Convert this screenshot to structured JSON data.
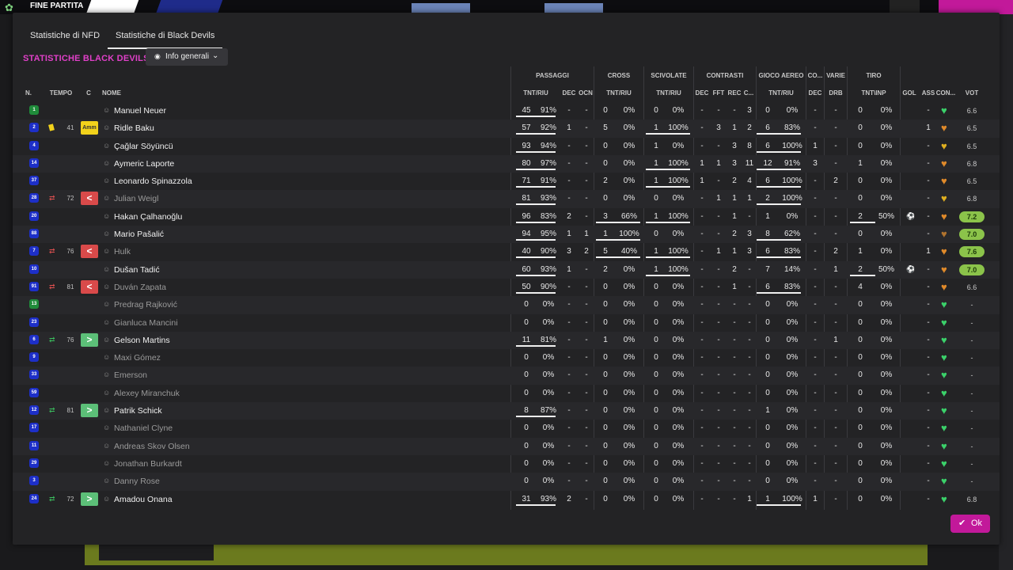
{
  "background": {
    "top_label": "FINE PARTITA"
  },
  "tabs": [
    {
      "label": "Statistiche di NFD",
      "active": false
    },
    {
      "label": "Statistiche di Black Devils",
      "active": true
    }
  ],
  "section_title": "STATISTICHE BLACK DEVILS",
  "view_dropdown": {
    "selected": "Info generali",
    "icon": "eye-icon"
  },
  "column_groups": {
    "passaggi": "PASSAGGI",
    "cross": "CROSS",
    "scivolate": "SCIVOLATE",
    "contrasti": "CONTRASTI",
    "gioco_aereo": "GIOCO AEREO",
    "co": "CO...",
    "varie": "VARIE",
    "tiro": "TIRO"
  },
  "columns": {
    "n": "N.",
    "tempo": "TEMPO",
    "c": "C",
    "nome": "NOME",
    "pass_tntriu": "TNT/RIU",
    "pass_dec": "DEC",
    "pass_ocn": "OCN",
    "cross_tntriu": "TNT/RIU",
    "sciv_tntriu": "TNT/RIU",
    "con_dec": "DEC",
    "con_fft": "FFT",
    "con_rec": "REC",
    "con_c": "C...",
    "aereo_tntriu": "TNT/RIU",
    "co_dec": "DEC",
    "varie_drb": "DRB",
    "tiro_tntinp": "TNT\\INP",
    "gol": "GOL",
    "ass": "ASS",
    "con": "CON...",
    "vot": "VOT"
  },
  "players": [
    {
      "n": "1",
      "nc": "green",
      "tempo": "",
      "tipo": "",
      "c": "",
      "cbox": "",
      "name": "Manuel Neuer",
      "dim": false,
      "pt": "45",
      "pp": "91%",
      "pd": "-",
      "po": "-",
      "ct": "0",
      "cp": "0%",
      "st": "0",
      "sp": "0%",
      "kd": "-",
      "kf": "-",
      "kr": "-",
      "kc": "3",
      "at": "0",
      "ap": "0%",
      "od": "-",
      "vd": "-",
      "tt": "0",
      "tp": "0%",
      "gol": "",
      "ass": "-",
      "heart": "green",
      "vot": "6.6",
      "good": false,
      "bar_p": true,
      "bar_c": false,
      "bar_s": false,
      "bar_a": false,
      "bar_t": false
    },
    {
      "n": "2",
      "nc": "blue",
      "tempo": "41",
      "tipo": "card",
      "c": "Amm",
      "cbox": "amm",
      "name": "Ridle Baku",
      "dim": false,
      "pt": "57",
      "pp": "92%",
      "pd": "1",
      "po": "-",
      "ct": "5",
      "cp": "0%",
      "st": "1",
      "sp": "100%",
      "kd": "-",
      "kf": "3",
      "kr": "1",
      "kc": "2",
      "at": "6",
      "ap": "83%",
      "od": "-",
      "vd": "-",
      "tt": "0",
      "tp": "0%",
      "gol": "",
      "ass": "1",
      "heart": "orange",
      "vot": "6.5",
      "good": false,
      "bar_p": true,
      "bar_c": false,
      "bar_s": true,
      "bar_a": true,
      "bar_t": false
    },
    {
      "n": "4",
      "nc": "blue",
      "tempo": "",
      "tipo": "",
      "c": "",
      "cbox": "",
      "name": "Çağlar Söyüncü",
      "dim": false,
      "pt": "93",
      "pp": "94%",
      "pd": "-",
      "po": "-",
      "ct": "0",
      "cp": "0%",
      "st": "1",
      "sp": "0%",
      "kd": "-",
      "kf": "-",
      "kr": "3",
      "kc": "8",
      "at": "6",
      "ap": "100%",
      "od": "1",
      "vd": "-",
      "tt": "0",
      "tp": "0%",
      "gol": "",
      "ass": "-",
      "heart": "yellow",
      "vot": "6.5",
      "good": false,
      "bar_p": true,
      "bar_c": false,
      "bar_s": false,
      "bar_a": true,
      "bar_t": false
    },
    {
      "n": "14",
      "nc": "blue",
      "tempo": "",
      "tipo": "",
      "c": "",
      "cbox": "",
      "name": "Aymeric Laporte",
      "dim": false,
      "pt": "80",
      "pp": "97%",
      "pd": "-",
      "po": "-",
      "ct": "0",
      "cp": "0%",
      "st": "1",
      "sp": "100%",
      "kd": "1",
      "kf": "1",
      "kr": "3",
      "kc": "11",
      "at": "12",
      "ap": "91%",
      "od": "3",
      "vd": "-",
      "tt": "1",
      "tp": "0%",
      "gol": "",
      "ass": "-",
      "heart": "orange",
      "vot": "6.8",
      "good": false,
      "bar_p": true,
      "bar_c": false,
      "bar_s": true,
      "bar_a": true,
      "bar_t": false
    },
    {
      "n": "37",
      "nc": "blue",
      "tempo": "",
      "tipo": "",
      "c": "",
      "cbox": "",
      "name": "Leonardo Spinazzola",
      "dim": false,
      "pt": "71",
      "pp": "91%",
      "pd": "-",
      "po": "-",
      "ct": "2",
      "cp": "0%",
      "st": "1",
      "sp": "100%",
      "kd": "1",
      "kf": "-",
      "kr": "2",
      "kc": "4",
      "at": "6",
      "ap": "100%",
      "od": "-",
      "vd": "2",
      "tt": "0",
      "tp": "0%",
      "gol": "",
      "ass": "-",
      "heart": "orange",
      "vot": "6.5",
      "good": false,
      "bar_p": true,
      "bar_c": false,
      "bar_s": true,
      "bar_a": true,
      "bar_t": false
    },
    {
      "n": "28",
      "nc": "blue",
      "tempo": "72",
      "tipo": "out",
      "c": "<",
      "cbox": "red",
      "name": "Julian Weigl",
      "dim": true,
      "pt": "81",
      "pp": "93%",
      "pd": "-",
      "po": "-",
      "ct": "0",
      "cp": "0%",
      "st": "0",
      "sp": "0%",
      "kd": "-",
      "kf": "1",
      "kr": "1",
      "kc": "1",
      "at": "2",
      "ap": "100%",
      "od": "-",
      "vd": "-",
      "tt": "0",
      "tp": "0%",
      "gol": "",
      "ass": "-",
      "heart": "yellow",
      "vot": "6.8",
      "good": false,
      "bar_p": true,
      "bar_c": false,
      "bar_s": false,
      "bar_a": true,
      "bar_t": false
    },
    {
      "n": "20",
      "nc": "blue",
      "tempo": "",
      "tipo": "",
      "c": "",
      "cbox": "",
      "name": "Hakan Çalhanoğlu",
      "dim": false,
      "pt": "96",
      "pp": "83%",
      "pd": "2",
      "po": "-",
      "ct": "3",
      "cp": "66%",
      "st": "1",
      "sp": "100%",
      "kd": "-",
      "kf": "-",
      "kr": "1",
      "kc": "-",
      "at": "1",
      "ap": "0%",
      "od": "-",
      "vd": "-",
      "tt": "2",
      "tp": "50%",
      "gol": "ball",
      "ass": "-",
      "heart": "orange",
      "vot": "7.2",
      "good": true,
      "bar_p": true,
      "bar_c": true,
      "bar_s": true,
      "bar_a": false,
      "bar_t": true
    },
    {
      "n": "88",
      "nc": "blue",
      "tempo": "",
      "tipo": "",
      "c": "",
      "cbox": "",
      "name": "Mario Pašalić",
      "dim": false,
      "pt": "94",
      "pp": "95%",
      "pd": "1",
      "po": "1",
      "ct": "1",
      "cp": "100%",
      "st": "0",
      "sp": "0%",
      "kd": "-",
      "kf": "-",
      "kr": "2",
      "kc": "3",
      "at": "8",
      "ap": "62%",
      "od": "-",
      "vd": "-",
      "tt": "0",
      "tp": "0%",
      "gol": "",
      "ass": "-",
      "heart": "brown",
      "vot": "7.0",
      "good": true,
      "bar_p": true,
      "bar_c": true,
      "bar_s": false,
      "bar_a": true,
      "bar_t": false
    },
    {
      "n": "7",
      "nc": "blue",
      "tempo": "76",
      "tipo": "out",
      "c": "<",
      "cbox": "red",
      "name": "Hulk",
      "dim": true,
      "pt": "40",
      "pp": "90%",
      "pd": "3",
      "po": "2",
      "ct": "5",
      "cp": "40%",
      "st": "1",
      "sp": "100%",
      "kd": "-",
      "kf": "1",
      "kr": "1",
      "kc": "3",
      "at": "6",
      "ap": "83%",
      "od": "-",
      "vd": "2",
      "tt": "1",
      "tp": "0%",
      "gol": "",
      "ass": "1",
      "heart": "orange",
      "vot": "7.6",
      "good": true,
      "bar_p": true,
      "bar_c": true,
      "bar_s": true,
      "bar_a": true,
      "bar_t": false
    },
    {
      "n": "10",
      "nc": "blue",
      "tempo": "",
      "tipo": "",
      "c": "",
      "cbox": "",
      "name": "Dušan Tadić",
      "dim": false,
      "pt": "60",
      "pp": "93%",
      "pd": "1",
      "po": "-",
      "ct": "2",
      "cp": "0%",
      "st": "1",
      "sp": "100%",
      "kd": "-",
      "kf": "-",
      "kr": "2",
      "kc": "-",
      "at": "7",
      "ap": "14%",
      "od": "-",
      "vd": "1",
      "tt": "2",
      "tp": "50%",
      "gol": "ball",
      "ass": "-",
      "heart": "orange",
      "vot": "7.0",
      "good": true,
      "bar_p": true,
      "bar_c": false,
      "bar_s": true,
      "bar_a": false,
      "bar_t": true
    },
    {
      "n": "91",
      "nc": "blue",
      "tempo": "81",
      "tipo": "out",
      "c": "<",
      "cbox": "red",
      "name": "Duván Zapata",
      "dim": true,
      "pt": "50",
      "pp": "90%",
      "pd": "-",
      "po": "-",
      "ct": "0",
      "cp": "0%",
      "st": "0",
      "sp": "0%",
      "kd": "-",
      "kf": "-",
      "kr": "1",
      "kc": "-",
      "at": "6",
      "ap": "83%",
      "od": "-",
      "vd": "-",
      "tt": "4",
      "tp": "0%",
      "gol": "",
      "ass": "-",
      "heart": "orange",
      "vot": "6.6",
      "good": false,
      "bar_p": true,
      "bar_c": false,
      "bar_s": false,
      "bar_a": true,
      "bar_t": false
    },
    {
      "n": "13",
      "nc": "green",
      "tempo": "",
      "tipo": "",
      "c": "",
      "cbox": "",
      "name": "Predrag Rajković",
      "dim": true,
      "pt": "0",
      "pp": "0%",
      "pd": "-",
      "po": "-",
      "ct": "0",
      "cp": "0%",
      "st": "0",
      "sp": "0%",
      "kd": "-",
      "kf": "-",
      "kr": "-",
      "kc": "-",
      "at": "0",
      "ap": "0%",
      "od": "-",
      "vd": "-",
      "tt": "0",
      "tp": "0%",
      "gol": "",
      "ass": "-",
      "heart": "green",
      "vot": "-",
      "good": false,
      "bar_p": false,
      "bar_c": false,
      "bar_s": false,
      "bar_a": false,
      "bar_t": false
    },
    {
      "n": "23",
      "nc": "blue",
      "tempo": "",
      "tipo": "",
      "c": "",
      "cbox": "",
      "name": "Gianluca Mancini",
      "dim": true,
      "pt": "0",
      "pp": "0%",
      "pd": "-",
      "po": "-",
      "ct": "0",
      "cp": "0%",
      "st": "0",
      "sp": "0%",
      "kd": "-",
      "kf": "-",
      "kr": "-",
      "kc": "-",
      "at": "0",
      "ap": "0%",
      "od": "-",
      "vd": "-",
      "tt": "0",
      "tp": "0%",
      "gol": "",
      "ass": "-",
      "heart": "green",
      "vot": "-",
      "good": false,
      "bar_p": false,
      "bar_c": false,
      "bar_s": false,
      "bar_a": false,
      "bar_t": false
    },
    {
      "n": "6",
      "nc": "blue",
      "tempo": "76",
      "tipo": "in",
      "c": ">",
      "cbox": "green",
      "name": "Gelson Martins",
      "dim": false,
      "pt": "11",
      "pp": "81%",
      "pd": "-",
      "po": "-",
      "ct": "1",
      "cp": "0%",
      "st": "0",
      "sp": "0%",
      "kd": "-",
      "kf": "-",
      "kr": "-",
      "kc": "-",
      "at": "0",
      "ap": "0%",
      "od": "-",
      "vd": "1",
      "tt": "0",
      "tp": "0%",
      "gol": "",
      "ass": "-",
      "heart": "green",
      "vot": "-",
      "good": false,
      "bar_p": true,
      "bar_c": false,
      "bar_s": false,
      "bar_a": false,
      "bar_t": false
    },
    {
      "n": "9",
      "nc": "blue",
      "tempo": "",
      "tipo": "",
      "c": "",
      "cbox": "",
      "name": "Maxi Gómez",
      "dim": true,
      "pt": "0",
      "pp": "0%",
      "pd": "-",
      "po": "-",
      "ct": "0",
      "cp": "0%",
      "st": "0",
      "sp": "0%",
      "kd": "-",
      "kf": "-",
      "kr": "-",
      "kc": "-",
      "at": "0",
      "ap": "0%",
      "od": "-",
      "vd": "-",
      "tt": "0",
      "tp": "0%",
      "gol": "",
      "ass": "-",
      "heart": "green",
      "vot": "-",
      "good": false,
      "bar_p": false,
      "bar_c": false,
      "bar_s": false,
      "bar_a": false,
      "bar_t": false
    },
    {
      "n": "33",
      "nc": "blue",
      "tempo": "",
      "tipo": "",
      "c": "",
      "cbox": "",
      "name": "Emerson",
      "dim": true,
      "pt": "0",
      "pp": "0%",
      "pd": "-",
      "po": "-",
      "ct": "0",
      "cp": "0%",
      "st": "0",
      "sp": "0%",
      "kd": "-",
      "kf": "-",
      "kr": "-",
      "kc": "-",
      "at": "0",
      "ap": "0%",
      "od": "-",
      "vd": "-",
      "tt": "0",
      "tp": "0%",
      "gol": "",
      "ass": "-",
      "heart": "green",
      "vot": "-",
      "good": false,
      "bar_p": false,
      "bar_c": false,
      "bar_s": false,
      "bar_a": false,
      "bar_t": false
    },
    {
      "n": "59",
      "nc": "blue",
      "tempo": "",
      "tipo": "",
      "c": "",
      "cbox": "",
      "name": "Alexey Miranchuk",
      "dim": true,
      "pt": "0",
      "pp": "0%",
      "pd": "-",
      "po": "-",
      "ct": "0",
      "cp": "0%",
      "st": "0",
      "sp": "0%",
      "kd": "-",
      "kf": "-",
      "kr": "-",
      "kc": "-",
      "at": "0",
      "ap": "0%",
      "od": "-",
      "vd": "-",
      "tt": "0",
      "tp": "0%",
      "gol": "",
      "ass": "-",
      "heart": "green",
      "vot": "-",
      "good": false,
      "bar_p": false,
      "bar_c": false,
      "bar_s": false,
      "bar_a": false,
      "bar_t": false
    },
    {
      "n": "12",
      "nc": "blue",
      "tempo": "81",
      "tipo": "in",
      "c": ">",
      "cbox": "green",
      "name": "Patrik Schick",
      "dim": false,
      "pt": "8",
      "pp": "87%",
      "pd": "-",
      "po": "-",
      "ct": "0",
      "cp": "0%",
      "st": "0",
      "sp": "0%",
      "kd": "-",
      "kf": "-",
      "kr": "-",
      "kc": "-",
      "at": "1",
      "ap": "0%",
      "od": "-",
      "vd": "-",
      "tt": "0",
      "tp": "0%",
      "gol": "",
      "ass": "-",
      "heart": "green",
      "vot": "-",
      "good": false,
      "bar_p": true,
      "bar_c": false,
      "bar_s": false,
      "bar_a": false,
      "bar_t": false
    },
    {
      "n": "17",
      "nc": "blue",
      "tempo": "",
      "tipo": "",
      "c": "",
      "cbox": "",
      "name": "Nathaniel Clyne",
      "dim": true,
      "pt": "0",
      "pp": "0%",
      "pd": "-",
      "po": "-",
      "ct": "0",
      "cp": "0%",
      "st": "0",
      "sp": "0%",
      "kd": "-",
      "kf": "-",
      "kr": "-",
      "kc": "-",
      "at": "0",
      "ap": "0%",
      "od": "-",
      "vd": "-",
      "tt": "0",
      "tp": "0%",
      "gol": "",
      "ass": "-",
      "heart": "green",
      "vot": "-",
      "good": false,
      "bar_p": false,
      "bar_c": false,
      "bar_s": false,
      "bar_a": false,
      "bar_t": false
    },
    {
      "n": "11",
      "nc": "blue",
      "tempo": "",
      "tipo": "",
      "c": "",
      "cbox": "",
      "name": "Andreas Skov Olsen",
      "dim": true,
      "pt": "0",
      "pp": "0%",
      "pd": "-",
      "po": "-",
      "ct": "0",
      "cp": "0%",
      "st": "0",
      "sp": "0%",
      "kd": "-",
      "kf": "-",
      "kr": "-",
      "kc": "-",
      "at": "0",
      "ap": "0%",
      "od": "-",
      "vd": "-",
      "tt": "0",
      "tp": "0%",
      "gol": "",
      "ass": "-",
      "heart": "green",
      "vot": "-",
      "good": false,
      "bar_p": false,
      "bar_c": false,
      "bar_s": false,
      "bar_a": false,
      "bar_t": false
    },
    {
      "n": "29",
      "nc": "blue",
      "tempo": "",
      "tipo": "",
      "c": "",
      "cbox": "",
      "name": "Jonathan Burkardt",
      "dim": true,
      "pt": "0",
      "pp": "0%",
      "pd": "-",
      "po": "-",
      "ct": "0",
      "cp": "0%",
      "st": "0",
      "sp": "0%",
      "kd": "-",
      "kf": "-",
      "kr": "-",
      "kc": "-",
      "at": "0",
      "ap": "0%",
      "od": "-",
      "vd": "-",
      "tt": "0",
      "tp": "0%",
      "gol": "",
      "ass": "-",
      "heart": "green",
      "vot": "-",
      "good": false,
      "bar_p": false,
      "bar_c": false,
      "bar_s": false,
      "bar_a": false,
      "bar_t": false
    },
    {
      "n": "3",
      "nc": "blue",
      "tempo": "",
      "tipo": "",
      "c": "",
      "cbox": "",
      "name": "Danny Rose",
      "dim": true,
      "pt": "0",
      "pp": "0%",
      "pd": "-",
      "po": "-",
      "ct": "0",
      "cp": "0%",
      "st": "0",
      "sp": "0%",
      "kd": "-",
      "kf": "-",
      "kr": "-",
      "kc": "-",
      "at": "0",
      "ap": "0%",
      "od": "-",
      "vd": "-",
      "tt": "0",
      "tp": "0%",
      "gol": "",
      "ass": "-",
      "heart": "green",
      "vot": "-",
      "good": false,
      "bar_p": false,
      "bar_c": false,
      "bar_s": false,
      "bar_a": false,
      "bar_t": false
    },
    {
      "n": "24",
      "nc": "blue",
      "tempo": "72",
      "tipo": "in",
      "c": ">",
      "cbox": "green",
      "name": "Amadou Onana",
      "dim": false,
      "pt": "31",
      "pp": "93%",
      "pd": "2",
      "po": "-",
      "ct": "0",
      "cp": "0%",
      "st": "0",
      "sp": "0%",
      "kd": "-",
      "kf": "-",
      "kr": "-",
      "kc": "1",
      "at": "1",
      "ap": "100%",
      "od": "1",
      "vd": "-",
      "tt": "0",
      "tp": "0%",
      "gol": "",
      "ass": "-",
      "heart": "green",
      "vot": "6.8",
      "good": false,
      "bar_p": true,
      "bar_c": false,
      "bar_s": false,
      "bar_a": true,
      "bar_t": false
    }
  ],
  "ok_button": {
    "label": "Ok"
  },
  "colors": {
    "accent": "#c2199a",
    "title": "#e040c8",
    "card_yellow": "#f2d21b",
    "sub_out": "#d94a4a",
    "sub_in": "#5cbf78",
    "good_vote": "#8bc34a"
  }
}
